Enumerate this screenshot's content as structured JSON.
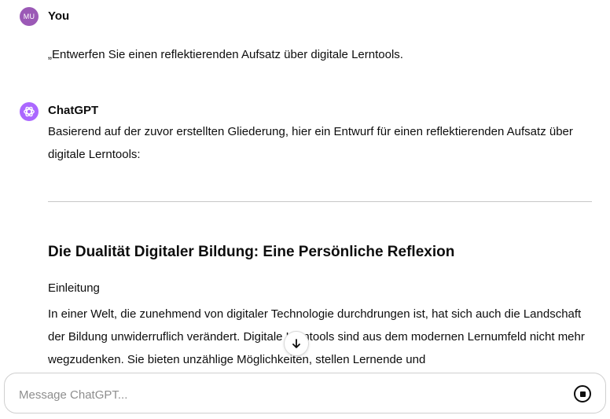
{
  "user": {
    "avatar_initials": "MU",
    "author": "You",
    "message": "„Entwerfen Sie einen reflektierenden Aufsatz über digitale Lerntools."
  },
  "assistant": {
    "author": "ChatGPT",
    "intro": "Basierend auf der zuvor erstellten Gliederung, hier ein Entwurf für einen reflektierenden Aufsatz über digitale Lerntools:",
    "essay_title": "Die Dualität Digitaler Bildung: Eine Persönliche Reflexion",
    "section_heading": "Einleitung",
    "body": "In einer Welt, die zunehmend von digitaler Technologie durchdrungen ist, hat sich auch die Landschaft der Bildung unwiderruflich verändert. Digitale Lerntools sind aus dem modernen Lernumfeld nicht mehr wegzudenken. Sie bieten unzählige Möglichkeiten, stellen Lernende und"
  },
  "composer": {
    "placeholder": "Message ChatGPT..."
  },
  "icons": {
    "assistant_logo": "openai-logo-icon",
    "scroll_down": "arrow-down-icon",
    "stop_generating": "stop-icon"
  },
  "colors": {
    "user_avatar": "#9b59b6",
    "assistant_avatar": "#ab68ff"
  }
}
